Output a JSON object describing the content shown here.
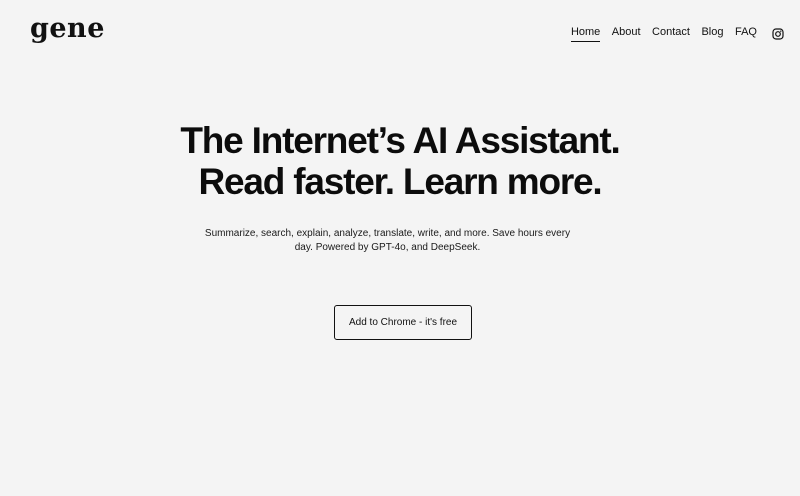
{
  "header": {
    "logo": "gene",
    "nav": [
      {
        "label": "Home",
        "active": true
      },
      {
        "label": "About",
        "active": false
      },
      {
        "label": "Contact",
        "active": false
      },
      {
        "label": "Blog",
        "active": false
      },
      {
        "label": "FAQ",
        "active": false
      }
    ],
    "social_icon": "instagram-icon"
  },
  "hero": {
    "title_line1": "The Internet’s AI Assistant.",
    "title_line2": "Read faster. Learn more.",
    "subtitle": "Summarize, search, explain, analyze, translate, write, and more. Save hours every day. Powered by GPT-4o, and DeepSeek.",
    "cta_label": "Add to Chrome - it's free"
  },
  "colors": {
    "background": "#f4f4f4",
    "text": "#111111"
  }
}
